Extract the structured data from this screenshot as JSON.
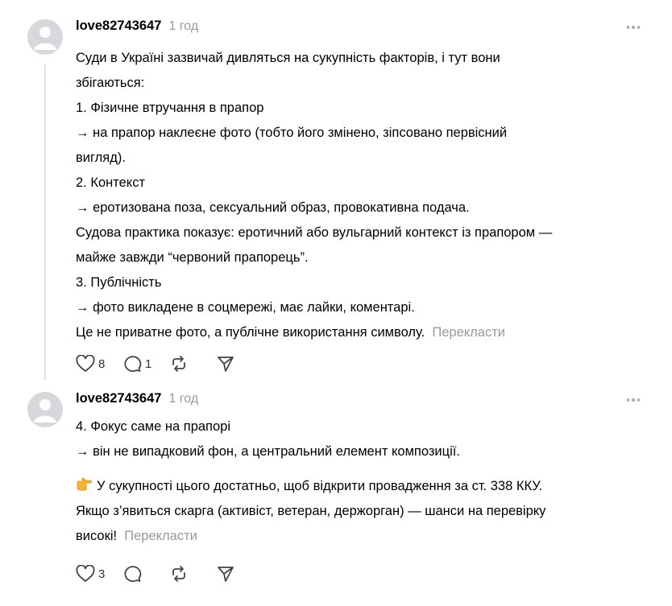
{
  "posts": [
    {
      "username": "love82743647",
      "time": "1 год",
      "lines": [
        "Суди в Україні зазвичай дивляться на сукупність факторів, і тут вони",
        "збігаються:",
        "1. Фізичне втручання в прапор",
        "→ на прапор наклеєне фото (тобто його змінено, зіпсовано первісний",
        "вигляд).",
        "2. Контекст",
        "→ еротизована поза, сексуальний образ, провокативна подача.",
        "Судова практика показує: еротичний або вульгарний контекст із прапором —",
        "майже завжди “червоний прапорець”.",
        "3. Публічність",
        "→ фото викладене в соцмережі, має лайки, коментарі."
      ],
      "last_line": "Це не приватне фото, а публічне використання символу.",
      "translate": "Перекласти",
      "likes": "8",
      "replies": "1",
      "reposts": "",
      "icons": [
        "heart-icon",
        "reply-icon",
        "repost-icon",
        "share-icon",
        "more-icon",
        "avatar-icon"
      ]
    },
    {
      "username": "love82743647",
      "time": "1 год",
      "lines": [
        "4. Фокус саме на прапорі",
        "→ він не випадковий фон, а центральний елемент композиції."
      ],
      "p2_line1": "У сукупності цього достатньо, щоб відкрити провадження за ст. 338 ККУ.",
      "p2_line2": "Якщо з’явиться скарга (активіст, ветеран, держорган) — шанси на перевірку",
      "p2_line3": "високі!",
      "translate": "Перекласти",
      "likes": "3",
      "replies": "",
      "reposts": "",
      "emoji": "point-right-emoji"
    }
  ],
  "colors": {
    "muted": "#999999",
    "thread_line": "#e0e0e0",
    "avatar_bg": "#d6d8db"
  }
}
